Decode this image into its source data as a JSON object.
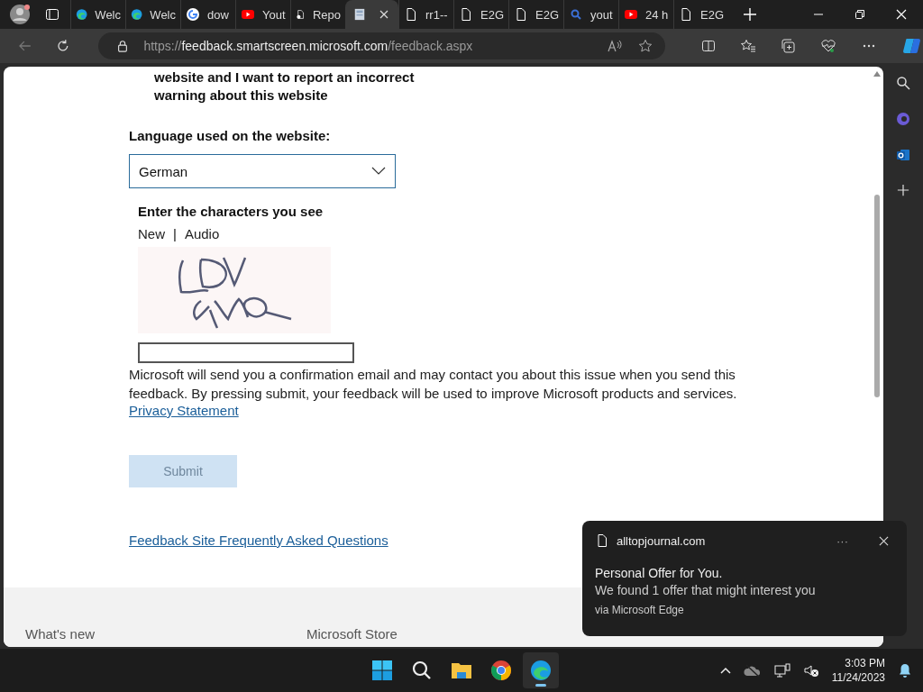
{
  "browser": {
    "tabs": [
      {
        "kind": "edge",
        "title": "Welc",
        "selected": false
      },
      {
        "kind": "edge",
        "title": "Welc",
        "selected": false
      },
      {
        "kind": "google",
        "title": "dow",
        "selected": false
      },
      {
        "kind": "youtube",
        "title": "Yout",
        "selected": false
      },
      {
        "kind": "report",
        "title": "Repo",
        "selected": false
      },
      {
        "kind": "thumb",
        "selected": true
      },
      {
        "kind": "doc",
        "title": "rr1--",
        "selected": false
      },
      {
        "kind": "doc",
        "title": "E2G",
        "selected": false
      },
      {
        "kind": "doc",
        "title": "E2G",
        "selected": false
      },
      {
        "kind": "search",
        "title": "yout",
        "selected": false
      },
      {
        "kind": "youtube",
        "title": "24 h",
        "selected": false
      },
      {
        "kind": "doc",
        "title": "E2G",
        "selected": false
      }
    ],
    "address": {
      "scheme": "https://",
      "host": "feedback.smartscreen.microsoft.com",
      "path": "/feedback.aspx"
    }
  },
  "page": {
    "option_text": "website and I want to report an incorrect warning about this website",
    "language_label": "Language used on the website:",
    "language_select": {
      "value": "German"
    },
    "captcha": {
      "heading": "Enter the characters you see",
      "links": [
        "New",
        "Audio"
      ],
      "separator": "|"
    },
    "notice": "Microsoft will send you a confirmation email and may contact you about this issue when you send this feedback. By pressing submit, your feedback will be used to improve Microsoft products and services.",
    "privacy_link": "Privacy Statement",
    "submit": {
      "label": "Submit",
      "disabled": true
    },
    "faq_link": "Feedback Site Frequently Asked Questions",
    "footer": [
      "What's new",
      "Microsoft Store"
    ]
  },
  "notification": {
    "site": "alltopjournal.com",
    "more": "···",
    "title": "Personal Offer for You.",
    "body": "We found 1 offer that might interest you",
    "via": "via Microsoft Edge"
  },
  "taskbar": {
    "apps": [
      {
        "kind": "start",
        "selected": false
      },
      {
        "kind": "search",
        "selected": false
      },
      {
        "kind": "files",
        "selected": false
      },
      {
        "kind": "chrome",
        "selected": false
      },
      {
        "kind": "edge",
        "selected": true
      }
    ],
    "time": "3:03 PM",
    "date": "11/24/2023"
  }
}
